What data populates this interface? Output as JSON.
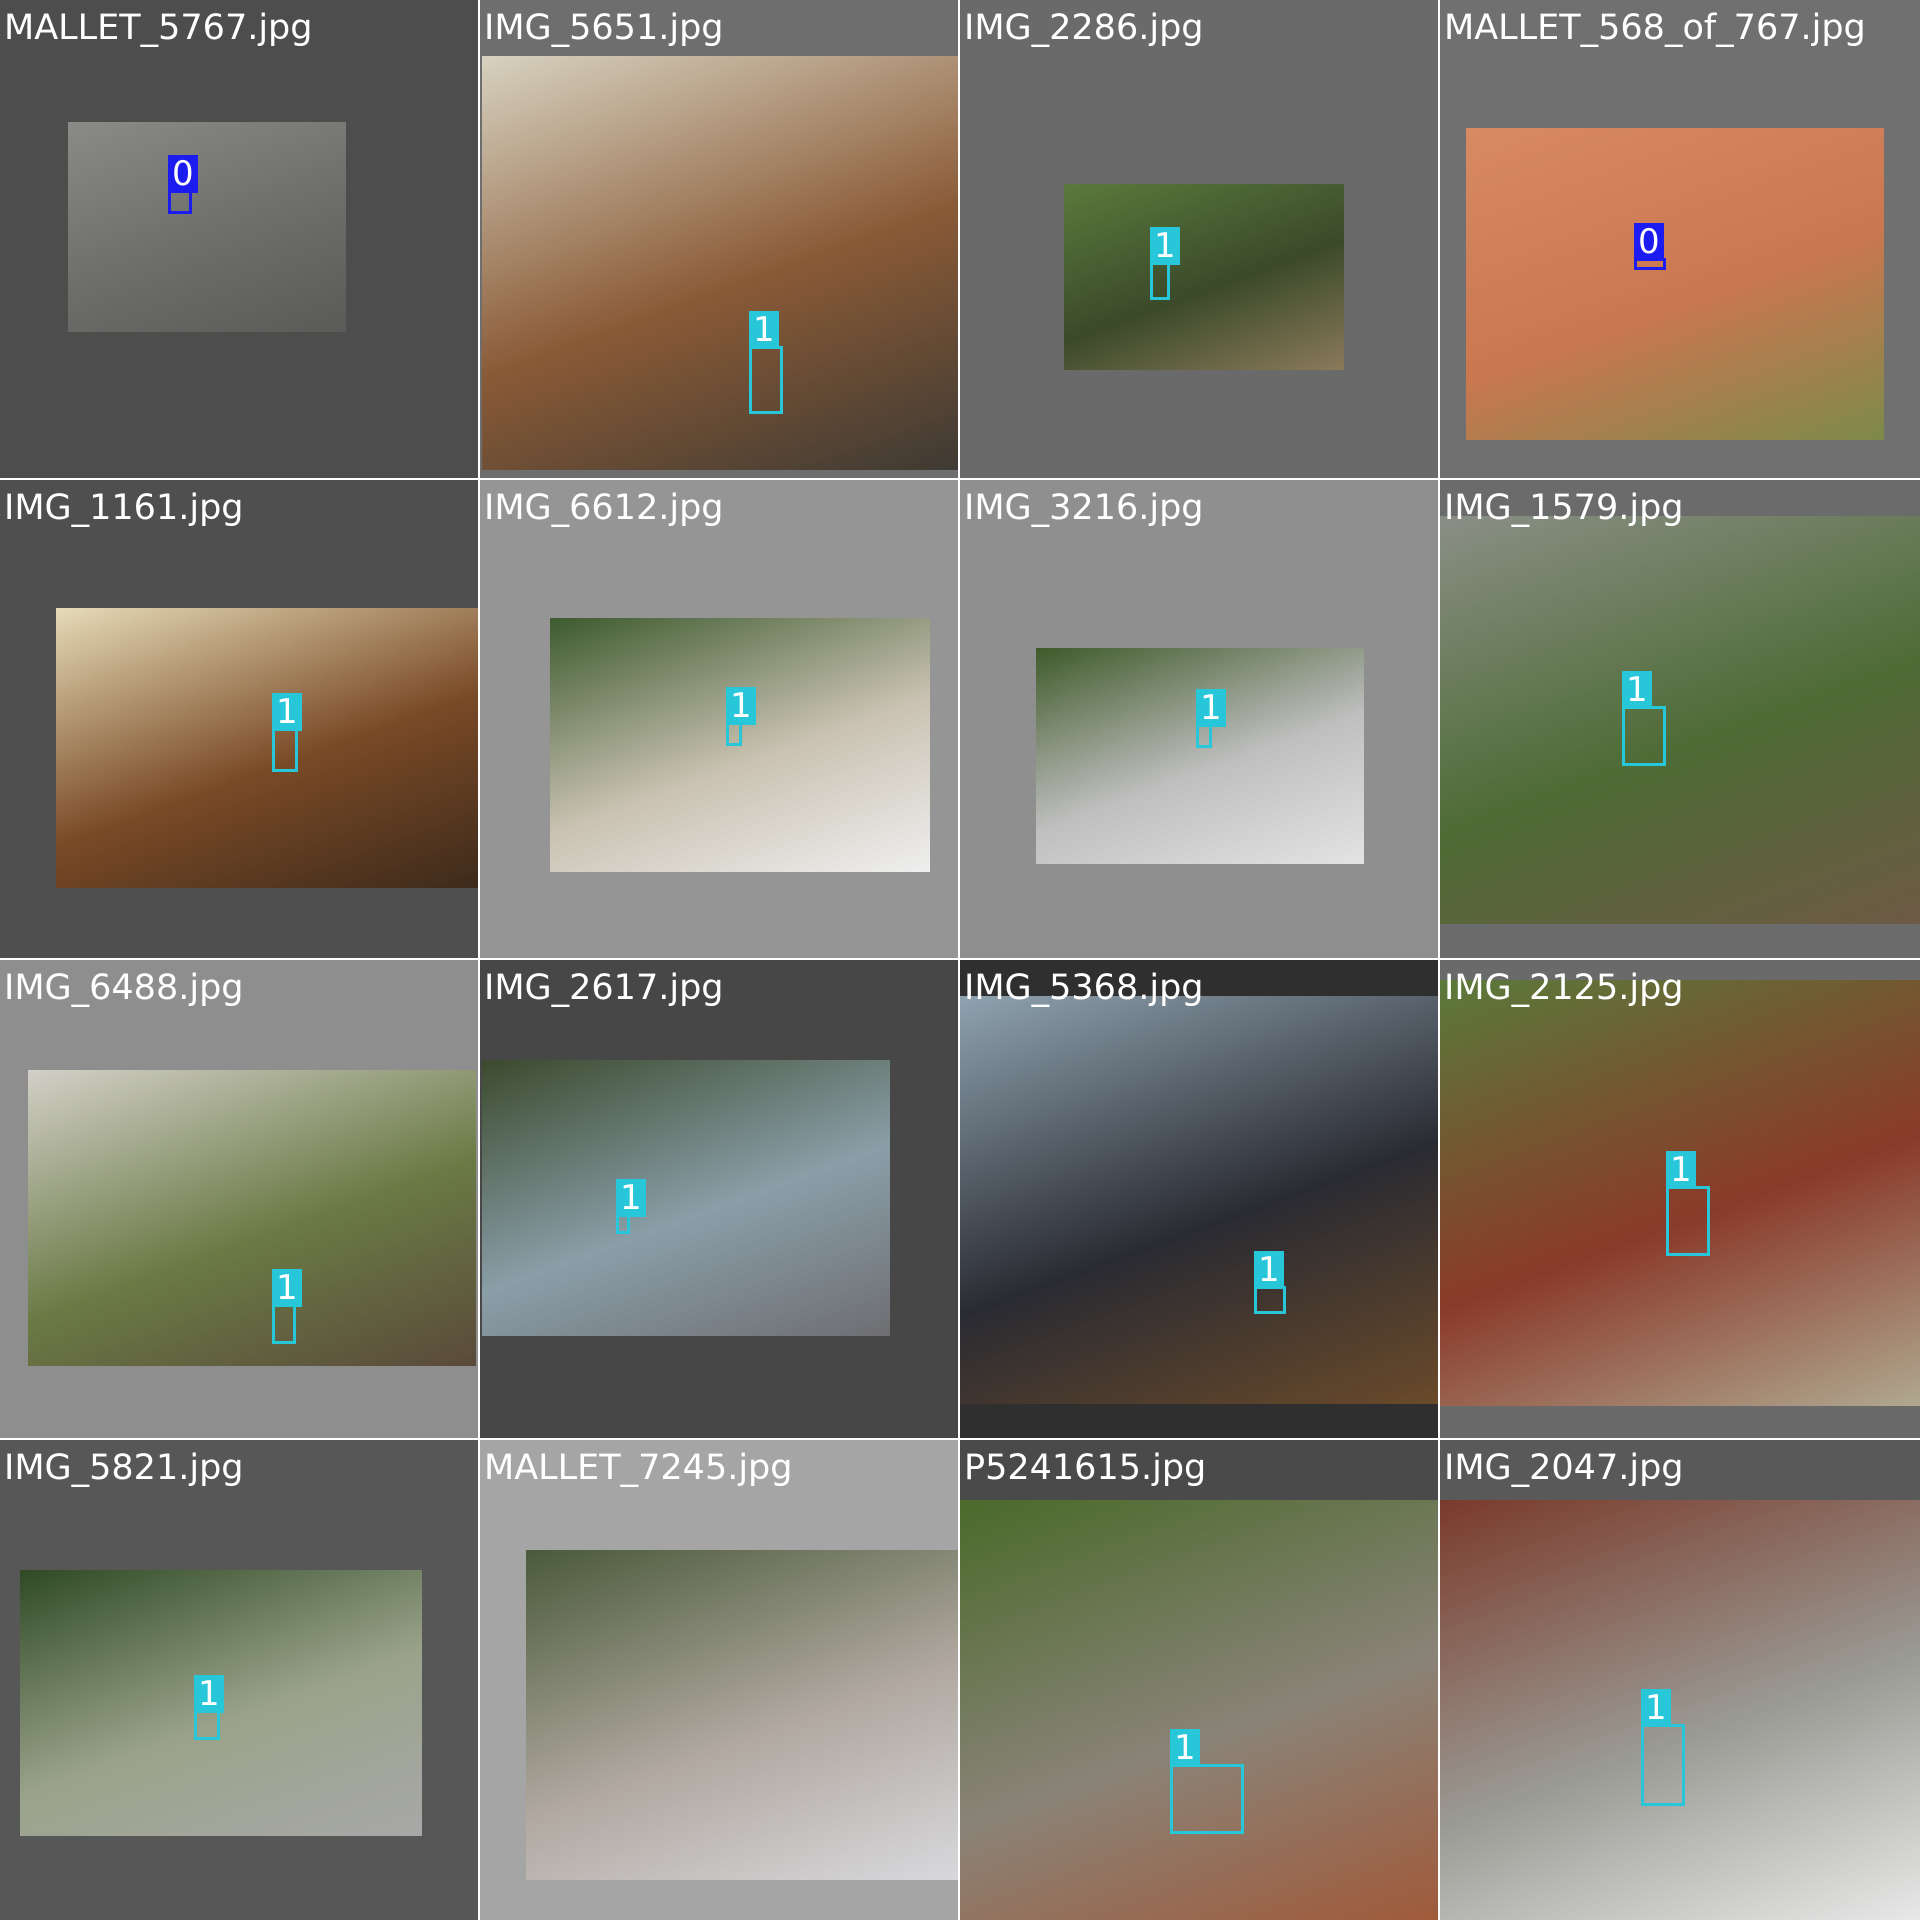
{
  "colors": {
    "class_0": "#1c1cf0",
    "class_1": "#27c6d8",
    "label_text": "#ffffff"
  },
  "tiles": [
    {
      "name": "MALLET_5767.jpg",
      "bg": "#4d4d4d",
      "photo_colors": [
        "#8a8a86",
        "#6d6d6a",
        "#5a5a57"
      ],
      "boxes": [
        {
          "cls": "0"
        }
      ]
    },
    {
      "name": "IMG_5651.jpg",
      "bg": "#6e6e6e",
      "photo_colors": [
        "#d7d2c0",
        "#8a5a36",
        "#3e3a33"
      ],
      "boxes": [
        {
          "cls": "1"
        }
      ]
    },
    {
      "name": "IMG_2286.jpg",
      "bg": "#6a6a6a",
      "photo_colors": [
        "#5b7a3c",
        "#3b4a2a",
        "#8a7a5a"
      ],
      "boxes": [
        {
          "cls": "1"
        }
      ]
    },
    {
      "name": "MALLET_568_of_767.jpg",
      "bg": "#707070",
      "photo_colors": [
        "#d88a63",
        "#c9774f",
        "#7d8a4a"
      ],
      "boxes": [
        {
          "cls": "0"
        }
      ]
    },
    {
      "name": "IMG_1161.jpg",
      "bg": "#4f4f4f",
      "photo_colors": [
        "#e6dbb8",
        "#7a4a26",
        "#3d2a1b"
      ],
      "boxes": [
        {
          "cls": "1"
        }
      ]
    },
    {
      "name": "IMG_6612.jpg",
      "bg": "#959595",
      "photo_colors": [
        "#3d5a2e",
        "#c9c2b2",
        "#efefef"
      ],
      "boxes": [
        {
          "cls": "1"
        }
      ]
    },
    {
      "name": "IMG_3216.jpg",
      "bg": "#8f8f8f",
      "photo_colors": [
        "#3f5a2a",
        "#bfbfbf",
        "#e3e3e3"
      ],
      "boxes": [
        {
          "cls": "1"
        }
      ]
    },
    {
      "name": "IMG_1579.jpg",
      "bg": "#6b6b6b",
      "photo_colors": [
        "#8a8f86",
        "#4e6b35",
        "#6e5a45"
      ],
      "boxes": [
        {
          "cls": "1"
        }
      ]
    },
    {
      "name": "IMG_6488.jpg",
      "bg": "#8e8e8e",
      "photo_colors": [
        "#d3d0c8",
        "#6a7a45",
        "#5a4a3a"
      ],
      "boxes": [
        {
          "cls": "1"
        }
      ]
    },
    {
      "name": "IMG_2617.jpg",
      "bg": "#474747",
      "photo_colors": [
        "#3b4a2d",
        "#8a9ea8",
        "#6e6e72"
      ],
      "boxes": [
        {
          "cls": "1"
        }
      ]
    },
    {
      "name": "IMG_5368.jpg",
      "bg": "#2f2f2f",
      "photo_colors": [
        "#8fa3b0",
        "#2a2b32",
        "#6a4a2a"
      ],
      "boxes": [
        {
          "cls": "1"
        }
      ]
    },
    {
      "name": "IMG_2125.jpg",
      "bg": "#6a6a6a",
      "photo_colors": [
        "#5a7a3a",
        "#8a3a2a",
        "#b0a890"
      ],
      "boxes": [
        {
          "cls": "1"
        }
      ]
    },
    {
      "name": "IMG_5821.jpg",
      "bg": "#575757",
      "photo_colors": [
        "#2f4a25",
        "#9aa38a",
        "#a8a8a8"
      ],
      "boxes": [
        {
          "cls": "1"
        }
      ]
    },
    {
      "name": "MALLET_7245.jpg",
      "bg": "#a5a5a5",
      "photo_colors": [
        "#4a5a3a",
        "#b0a8a0",
        "#d8d8dc"
      ],
      "boxes": []
    },
    {
      "name": "P5241615.jpg",
      "bg": "#4a4a4a",
      "photo_colors": [
        "#4a6a2a",
        "#8a8378",
        "#a05a3a"
      ],
      "boxes": [
        {
          "cls": "1"
        }
      ]
    },
    {
      "name": "IMG_2047.jpg",
      "bg": "#595959",
      "photo_colors": [
        "#7a3a2a",
        "#9a9a94",
        "#e8e8e8"
      ],
      "boxes": [
        {
          "cls": "1"
        }
      ]
    }
  ]
}
